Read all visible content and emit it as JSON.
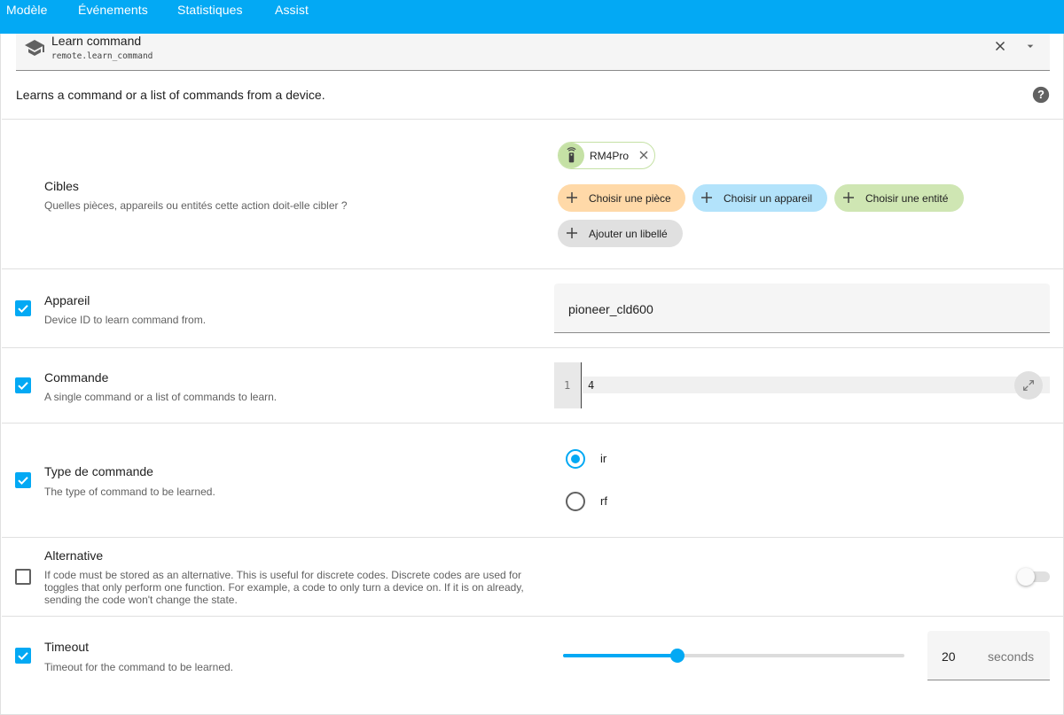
{
  "tabs": [
    {
      "label": "Modèle"
    },
    {
      "label": "Événements"
    },
    {
      "label": "Statistiques"
    },
    {
      "label": "Assist"
    }
  ],
  "action": {
    "title": "Learn command",
    "service": "remote.learn_command",
    "icon": "school-icon",
    "description": "Learns a command or a list of commands from a device."
  },
  "targets": {
    "title": "Cibles",
    "description": "Quelles pièces, appareils ou entités cette action doit-elle cibler ?",
    "selected_entity": "RM4Pro",
    "buttons": {
      "area": "Choisir une pièce",
      "device": "Choisir un appareil",
      "entity": "Choisir une entité",
      "label": "Ajouter un libellé"
    }
  },
  "device": {
    "enabled": true,
    "title": "Appareil",
    "description": "Device ID to learn command from.",
    "value": "pioneer_cld600"
  },
  "command": {
    "enabled": true,
    "title": "Commande",
    "description": "A single command or a list of commands to learn.",
    "line_number": "1",
    "value": "4"
  },
  "command_type": {
    "enabled": true,
    "title": "Type de commande",
    "description": "The type of command to be learned.",
    "options": [
      {
        "label": "ir",
        "selected": true
      },
      {
        "label": "rf",
        "selected": false
      }
    ]
  },
  "alternative": {
    "enabled": false,
    "title": "Alternative",
    "description_lines": [
      "If code must be stored as an alternative. This is useful for discrete codes. Discrete codes are used for",
      "toggles that only perform one function. For example, a code to only turn a device on. If it is on already,",
      "sending the code won't change the state."
    ],
    "toggle_on": false
  },
  "timeout": {
    "enabled": true,
    "title": "Timeout",
    "description": "Timeout for the command to be learned.",
    "value": "20",
    "unit": "seconds",
    "slider_fraction": 0.335
  },
  "colors": {
    "accent": "#03a9f4",
    "area_chip": "#ffd9a8",
    "device_chip": "#b3e3fb",
    "entity_chip": "#cfe6b3",
    "label_chip": "#e0e0e0"
  }
}
